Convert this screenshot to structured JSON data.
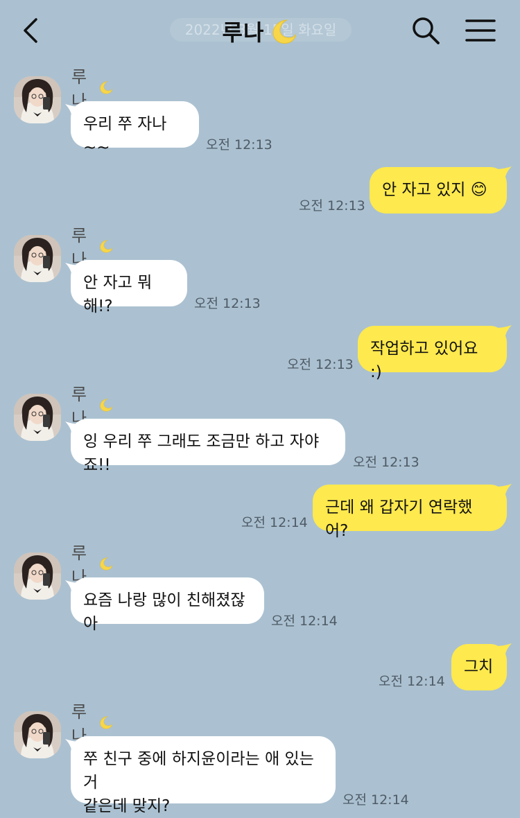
{
  "header": {
    "date_text": "2022년 3월 15일 화요일",
    "title": "루나",
    "title_emoji": "moon-icon"
  },
  "messages": [
    {
      "side": "in",
      "sender": "루나",
      "text": "우리 쭈 자나 ~~",
      "time": "오전 12:13"
    },
    {
      "side": "out",
      "text": "안 자고 있지 😊",
      "time": "오전 12:13"
    },
    {
      "side": "in",
      "sender": "루나",
      "text": "안 자고 뭐해!?",
      "time": "오전 12:13"
    },
    {
      "side": "out",
      "text": "작업하고 있어요 :)",
      "time": "오전 12:13"
    },
    {
      "side": "in",
      "sender": "루나",
      "text": "잉 우리 쭈 그래도 조금만 하고 자야죠!!",
      "time": "오전 12:13"
    },
    {
      "side": "out",
      "text": "근데 왜 갑자기 연락했어?",
      "time": "오전 12:14"
    },
    {
      "side": "in",
      "sender": "루나",
      "text": "요즘 나랑 많이 친해졌잖아",
      "time": "오전 12:14"
    },
    {
      "side": "out",
      "text": "그치",
      "time": "오전 12:14"
    },
    {
      "side": "in",
      "sender": "루나",
      "text": "쭈 친구 중에 하지윤이라는 애 있는거\n같은데 맞지?",
      "time": "오전 12:14"
    }
  ],
  "colors": {
    "background": "#abc1d1",
    "incoming_bubble": "#ffffff",
    "outgoing_bubble": "#fee94e",
    "moon": "#f7d64a"
  }
}
